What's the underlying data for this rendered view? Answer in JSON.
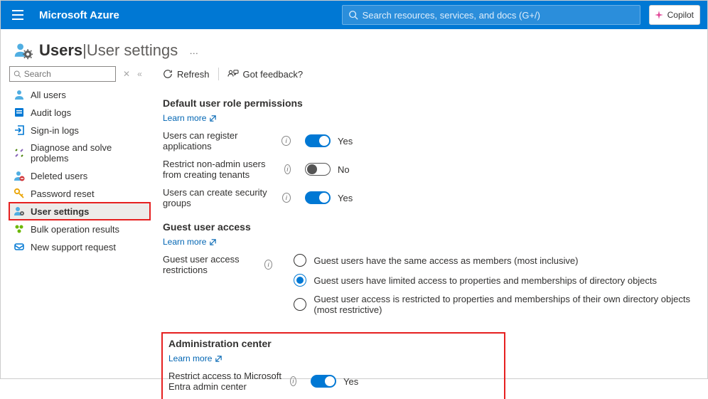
{
  "topbar": {
    "brand": "Microsoft Azure",
    "search_placeholder": "Search resources, services, and docs (G+/)",
    "copilot_label": "Copilot"
  },
  "blade": {
    "icon_name": "users-icon",
    "title_primary": "Users",
    "title_separator": " | ",
    "title_secondary": "User settings",
    "more": "…"
  },
  "sidebar": {
    "search_placeholder": "Search",
    "items": [
      {
        "label": "All users",
        "icon": "user-icon",
        "color": "#60b0e8"
      },
      {
        "label": "Audit logs",
        "icon": "audit-icon",
        "color": "#0078d4"
      },
      {
        "label": "Sign-in logs",
        "icon": "signin-icon",
        "color": "#0078d4"
      },
      {
        "label": "Diagnose and solve problems",
        "icon": "diagnose-icon",
        "color": "#8a8886"
      },
      {
        "label": "Deleted users",
        "icon": "deleted-user-icon",
        "color": "#60b0e8"
      },
      {
        "label": "Password reset",
        "icon": "key-icon",
        "color": "#eaa300"
      },
      {
        "label": "User settings",
        "icon": "user-settings-icon",
        "color": "#60b0e8",
        "active": true
      },
      {
        "label": "Bulk operation results",
        "icon": "bulk-icon",
        "color": "#6bb700"
      },
      {
        "label": "New support request",
        "icon": "support-icon",
        "color": "#0078d4"
      }
    ]
  },
  "toolbar": {
    "refresh_label": "Refresh",
    "feedback_label": "Got feedback?"
  },
  "sections": {
    "default_perms": {
      "title": "Default user role permissions",
      "learn_more": "Learn more",
      "row0_label": "Users can register applications",
      "row0_value": "Yes",
      "row1_label": "Restrict non-admin users from creating tenants",
      "row1_value": "No",
      "row2_label": "Users can create security groups",
      "row2_value": "Yes"
    },
    "guest": {
      "title": "Guest user access",
      "learn_more": "Learn more",
      "restrictions_label": "Guest user access restrictions",
      "options": [
        "Guest users have the same access as members (most inclusive)",
        "Guest users have limited access to properties and memberships of directory objects",
        "Guest user access is restricted to properties and memberships of their own directory objects (most restrictive)"
      ],
      "selected_index": 1
    },
    "admin": {
      "title": "Administration center",
      "learn_more": "Learn more",
      "row0_label": "Restrict access to Microsoft Entra admin center",
      "row0_value": "Yes"
    }
  }
}
